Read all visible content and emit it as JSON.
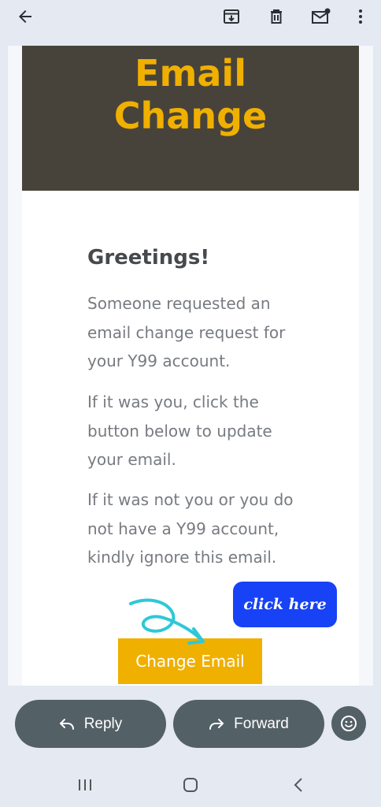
{
  "email": {
    "banner_title_line1": "Email",
    "banner_title_line2": "Change",
    "greeting": "Greetings!",
    "paragraphs": [
      "Someone requested an email change request for your Y99 account.",
      "If it was you, click the button below to update your email.",
      "If it was not you or you do not have a Y99 account, kindly ignore this email."
    ],
    "cta_label": "Change Email",
    "overlay_label": "click here"
  },
  "actions": {
    "reply_label": "Reply",
    "forward_label": "Forward"
  },
  "icons": {
    "top_bar": [
      "back-arrow-icon",
      "archive-icon",
      "delete-icon",
      "mark-unread-icon",
      "more-vert-icon"
    ],
    "bottom_nav": [
      "recent-apps-icon",
      "home-icon",
      "back-icon"
    ]
  },
  "colors": {
    "banner_bg": "#48433a",
    "accent": "#f0b000",
    "overlay_bg": "#1742f5",
    "doodle": "#2ec8d8",
    "pill_bg": "#536066"
  }
}
